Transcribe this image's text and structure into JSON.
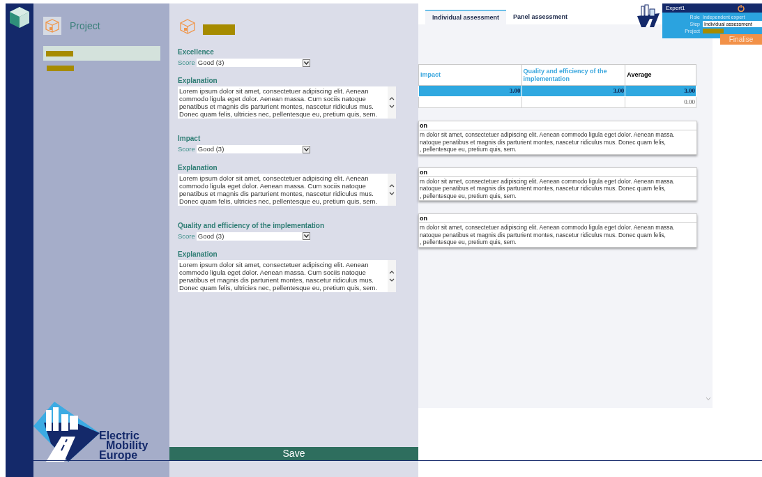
{
  "sidebar": {
    "title": "Project",
    "items": [
      {
        "selected": true
      },
      {
        "selected": false
      }
    ]
  },
  "form": {
    "sections": [
      {
        "label": "Excellence",
        "score_label": "Score",
        "score": "Good (3)",
        "explanation_label": "Explanation",
        "explanation": "Lorem ipsum dolor sit amet, consectetuer adipiscing elit. Aenean commodo ligula eget dolor. Aenean massa. Cum sociis natoque penatibus et magnis dis parturient montes, nascetur ridiculus mus. Donec quam felis, ultricies nec, pellentesque eu, pretium quis, sem."
      },
      {
        "label": "Impact",
        "score_label": "Score",
        "score": "Good (3)",
        "explanation_label": "Explanation",
        "explanation": "Lorem ipsum dolor sit amet, consectetuer adipiscing elit. Aenean commodo ligula eget dolor. Aenean massa. Cum sociis natoque penatibus et magnis dis parturient montes, nascetur ridiculus mus. Donec quam felis, ultricies nec, pellentesque eu, pretium quis, sem."
      },
      {
        "label": "Quality and efficiency of the implementation",
        "score_label": "Score",
        "score": "Good (3)",
        "explanation_label": "Explanation",
        "explanation": "Lorem ipsum dolor sit amet, consectetuer adipiscing elit. Aenean commodo ligula eget dolor. Aenean massa. Cum sociis natoque penatibus et magnis dis parturient montes, nascetur ridiculus mus. Donec quam felis, ultricies nec, pellentesque eu, pretium quis, sem."
      }
    ],
    "save": "Save"
  },
  "logo_text": [
    "Electric",
    "Mobility",
    "Europe"
  ],
  "tabs": [
    {
      "label": "Individual assessment",
      "selected": true
    },
    {
      "label": "Panel assessment",
      "selected": false
    }
  ],
  "user": {
    "name": "Expert1",
    "role_label": "Role",
    "role": "Independent expert",
    "step_label": "Step",
    "step": "Individual assessment",
    "project_label": "Project"
  },
  "finalise": "Finalise",
  "table": {
    "columns": [
      {
        "label": "Impact",
        "kind": "criterion"
      },
      {
        "label": "Quality and efficiency of the implementation",
        "kind": "criterion"
      },
      {
        "label": "Average",
        "kind": "summary"
      }
    ],
    "rows": [
      {
        "cells": [
          "3.00",
          "3.00",
          "3.00"
        ],
        "selected": true
      },
      {
        "cells": [
          null,
          null,
          "0.00"
        ],
        "selected": false
      }
    ]
  },
  "comments": [
    {
      "title": "on",
      "lines": [
        "m dolor sit amet, consectetuer adipiscing elit. Aenean commodo ligula eget dolor. Aenean massa.",
        "natoque penatibus et magnis dis parturient montes, nascetur ridiculus mus. Donec quam felis,",
        ", pellentesque eu, pretium quis, sem."
      ]
    },
    {
      "title": "on",
      "lines": [
        "m dolor sit amet, consectetuer adipiscing elit. Aenean commodo ligula eget dolor. Aenean massa.",
        "natoque penatibus et magnis dis parturient montes, nascetur ridiculus mus. Donec quam felis,",
        ", pellentesque eu, pretium quis, sem."
      ]
    },
    {
      "title": "on",
      "lines": [
        "m dolor sit amet, consectetuer adipiscing elit. Aenean commodo ligula eget dolor. Aenean massa.",
        "natoque penatibus et magnis dis parturient montes, nascetur ridiculus mus. Donec quam felis,",
        ", pellentesque eu, pretium quis, sem."
      ]
    }
  ]
}
